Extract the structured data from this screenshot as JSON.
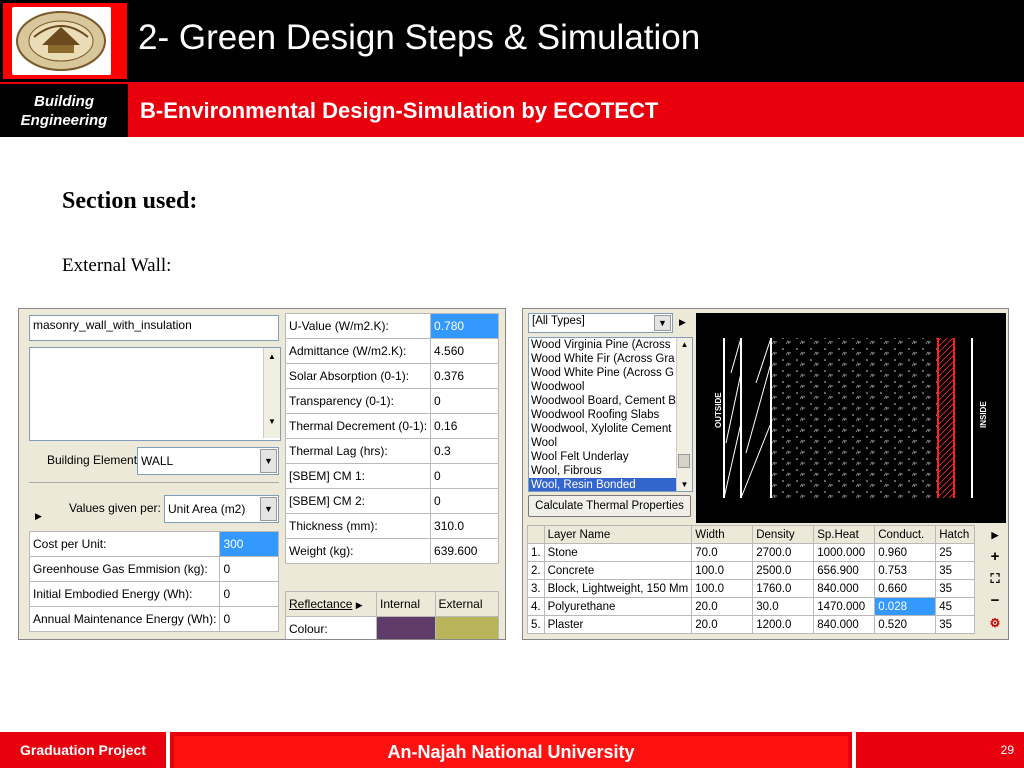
{
  "header": {
    "title": "2- Green Design Steps & Simulation",
    "department_line1": "Building",
    "department_line2": "Engineering",
    "subtitle": "B-Environmental Design-Simulation by ECOTECT"
  },
  "body": {
    "section_heading": "Section used:",
    "section_text": "External Wall:"
  },
  "element_panel": {
    "name_value": "masonry_wall_with_insulation",
    "building_element_label": "Building Element:",
    "building_element_value": "WALL",
    "values_given_per_label": "Values given per:",
    "values_given_per_value": "Unit Area (m2)",
    "cost_rows": [
      {
        "label": "Cost per Unit:",
        "value": "300"
      },
      {
        "label": "Greenhouse Gas Emmision (kg):",
        "value": "0"
      },
      {
        "label": "Initial Embodied Energy (Wh):",
        "value": "0"
      },
      {
        "label": "Annual Maintenance Energy (Wh):",
        "value": "0"
      }
    ],
    "property_rows": [
      {
        "label": "U-Value (W/m2.K):",
        "value": "0.780"
      },
      {
        "label": "Admittance (W/m2.K):",
        "value": "4.560"
      },
      {
        "label": "Solar Absorption (0-1):",
        "value": "0.376"
      },
      {
        "label": "Transparency (0-1):",
        "value": "0"
      },
      {
        "label": "Thermal Decrement (0-1):",
        "value": "0.16"
      },
      {
        "label": "Thermal Lag (hrs):",
        "value": "0.3"
      },
      {
        "label": "[SBEM] CM 1:",
        "value": "0"
      },
      {
        "label": "[SBEM] CM 2:",
        "value": "0"
      },
      {
        "label": "Thickness (mm):",
        "value": "310.0"
      },
      {
        "label": "Weight (kg):",
        "value": "639.600"
      }
    ],
    "reflectance_label": "Reflectance",
    "internal_label": "Internal",
    "external_label": "External",
    "colour_label": "Colour:",
    "colors": {
      "internal": "#5e3b68",
      "external": "#b9b35a",
      "selected": "#3399ff"
    }
  },
  "materials_panel": {
    "type_filter": "[All Types]",
    "materials": [
      "Wood Virginia Pine (Across",
      "Wood White Fir (Across Gra",
      "Wood White Pine (Across G",
      "Woodwool",
      "Woodwool Board, Cement B",
      "Woodwool Roofing Slabs",
      "Woodwool, Xylolite Cement",
      "Wool",
      "Wool Felt Underlay",
      "Wool, Fibrous",
      "Wool, Resin Bonded"
    ],
    "selected_material": "Wool, Resin Bonded",
    "calc_button": "Calculate Thermal Properties",
    "outside_label": "OUTSIDE",
    "inside_label": "INSIDE",
    "layer_headers": [
      "Layer Name",
      "Width",
      "Density",
      "Sp.Heat",
      "Conduct.",
      "Hatch"
    ],
    "layers": [
      {
        "num": "1.",
        "name": "Stone",
        "width": "70.0",
        "density": "2700.0",
        "spheat": "1000.000",
        "conduct": "0.960",
        "hatch": "25"
      },
      {
        "num": "2.",
        "name": "Concrete",
        "width": "100.0",
        "density": "2500.0",
        "spheat": "656.900",
        "conduct": "0.753",
        "hatch": "35"
      },
      {
        "num": "3.",
        "name": "Block, Lightweight, 150 Mm",
        "width": "100.0",
        "density": "1760.0",
        "spheat": "840.000",
        "conduct": "0.660",
        "hatch": "35"
      },
      {
        "num": "4.",
        "name": "Polyurethane",
        "width": "20.0",
        "density": "30.0",
        "spheat": "1470.000",
        "conduct": "0.028",
        "hatch": "45"
      },
      {
        "num": "5.",
        "name": "Plaster",
        "width": "20.0",
        "density": "1200.0",
        "spheat": "840.000",
        "conduct": "0.520",
        "hatch": "35"
      }
    ]
  },
  "footer": {
    "left": "Graduation Project",
    "center": "An-Najah National University",
    "page": "29"
  }
}
